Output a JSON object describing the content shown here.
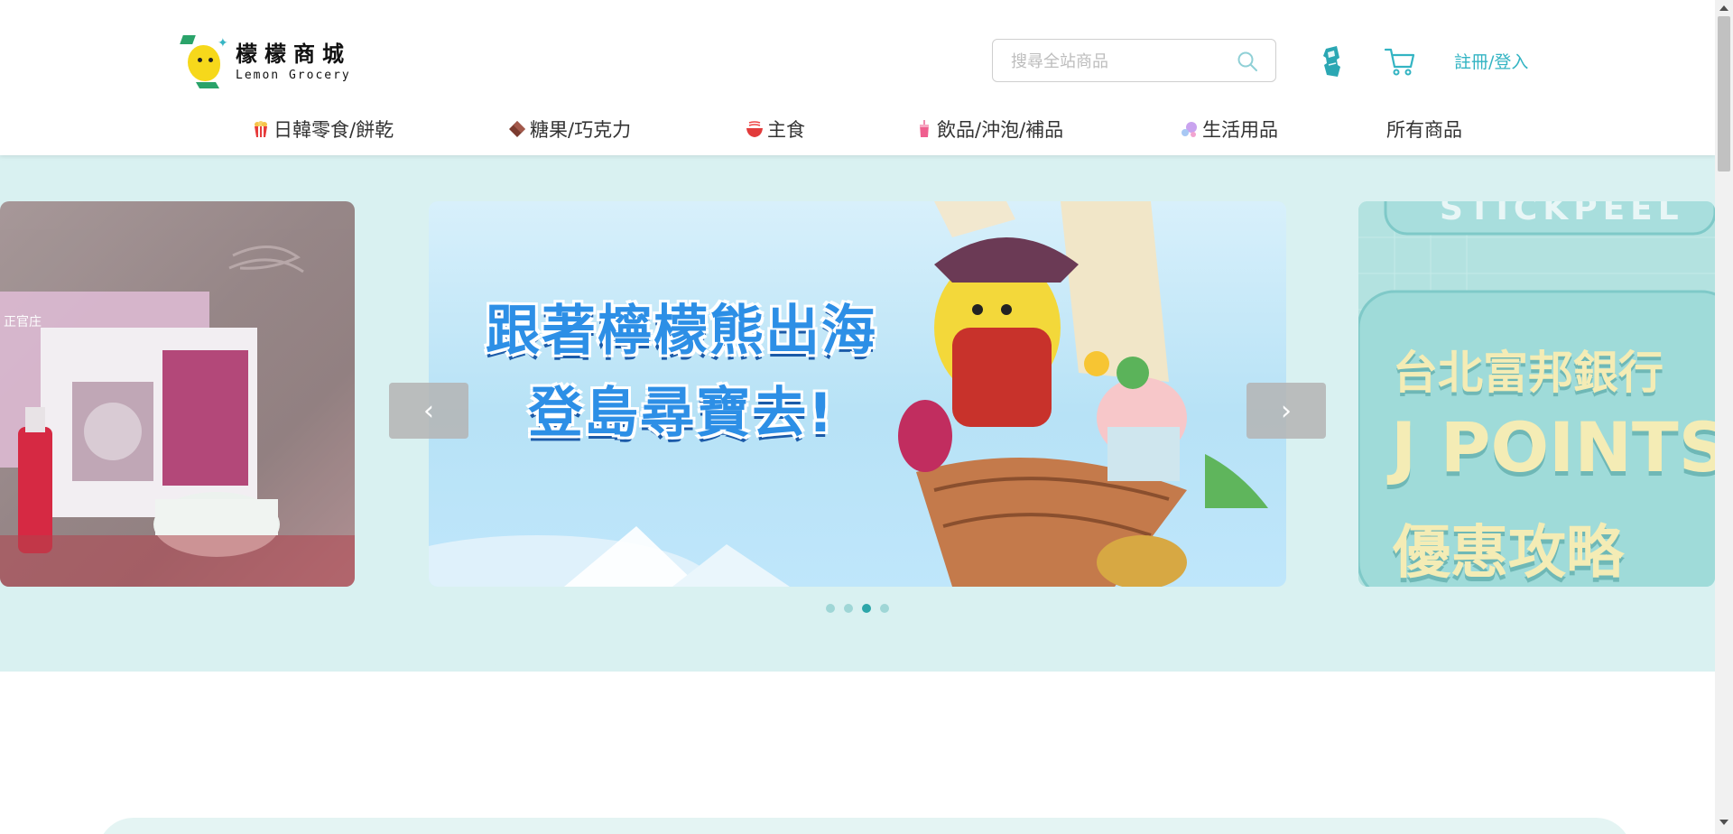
{
  "header": {
    "logo": {
      "name_cn": "檬檬商城",
      "name_en": "Lemon Grocery"
    },
    "search": {
      "placeholder": "搜尋全站商品",
      "value": ""
    },
    "login_label": "註冊/登入"
  },
  "nav": {
    "items": [
      {
        "label": "日韓零食/餅乾",
        "icon": "popcorn-icon"
      },
      {
        "label": "糖果/巧克力",
        "icon": "chocolate-icon"
      },
      {
        "label": "主食",
        "icon": "noodle-bowl-icon"
      },
      {
        "label": "飲品/沖泡/補品",
        "icon": "drink-cup-icon"
      },
      {
        "label": "生活用品",
        "icon": "bubbles-icon"
      },
      {
        "label": "所有商品",
        "icon": ""
      }
    ]
  },
  "carousel": {
    "slides": [
      {
        "id": "left",
        "text_lines": [
          "正官庄"
        ]
      },
      {
        "id": "center",
        "text_lines": [
          "跟著檸檬熊出海",
          "登島尋寶去!"
        ]
      },
      {
        "id": "right",
        "text_lines": [
          "STICKPEEL",
          "台北富邦銀行",
          "J POINTS",
          "優惠攻略"
        ]
      }
    ],
    "prev_label": "‹",
    "next_label": "›",
    "dot_count": 4,
    "active_dot": 3
  },
  "colors": {
    "accent": "#33b4c3",
    "hero_bg": "#d9f1f1",
    "dot_active": "#2ca6a9",
    "dot_inactive": "#9fd6d6"
  }
}
